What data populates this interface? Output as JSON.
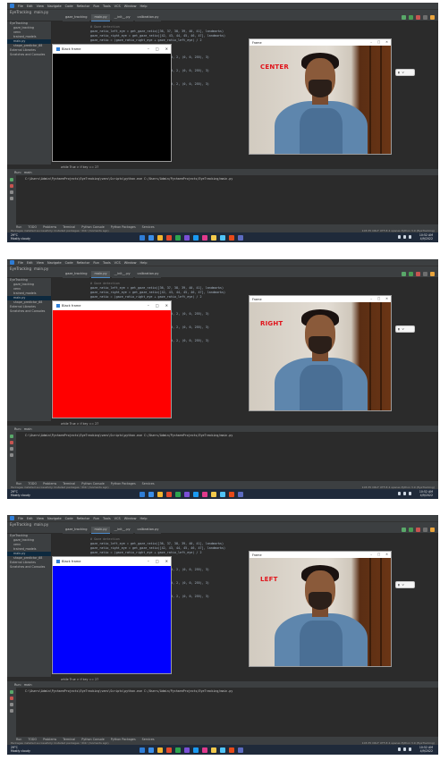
{
  "ide": {
    "menu": [
      "File",
      "Edit",
      "View",
      "Navigate",
      "Code",
      "Refactor",
      "Run",
      "Tools",
      "VCS",
      "Window",
      "Help"
    ],
    "breadcrumb": [
      "EyeTracking",
      "main.py"
    ],
    "tabs": [
      "gaze_tracking",
      "main.py",
      "__init__.py",
      "calibration.py"
    ],
    "project_tree": [
      "EyeTracking",
      "gaze_tracking",
      "venv",
      "trained_models",
      "main.py",
      "shape_predictor_68",
      "External Libraries",
      "Scratches and Consoles"
    ],
    "code_lines": [
      "# Gaze detection",
      "gaze_ratio_left_eye = get_gaze_ratio([36, 37, 38, 39, 40, 41], landmarks)",
      "gaze_ratio_right_eye = get_gaze_ratio([42, 43, 44, 45, 46, 47], landmarks)",
      "gaze_ratio = (gaze_ratio_right_eye + gaze_ratio_left_eye) / 2"
    ],
    "code_fragments": [
      "ed, 2, (0, 0, 255), 3)",
      "ed, 2, (0, 0, 255), 3)",
      "ed, 2, (0, 0, 255), 3)"
    ],
    "status_line": "while True  >  if key == 27",
    "run_tab": "main",
    "run_command": "C:\\Users\\Admin\\PycharmProjects\\EyeTracking\\venv\\Scripts\\python.exe C:/Users/Admin/PycharmProjects/EyeTracking/main.py",
    "bottom_tools": [
      "Run",
      "TODO",
      "Problems",
      "Terminal",
      "Python Console",
      "Python Packages",
      "Services"
    ],
    "statusbar_left": "Packages installed successfully: Installed packages: 'dlib' (moments ago)",
    "statusbar_right": "103:35  CRLF  UTF-8  4 spaces  Python 3.9 (EyeTracking)"
  },
  "taskbar": {
    "weather_temp": "29°C",
    "weather_desc": "Mostly cloudy",
    "time": "10:52 AM",
    "date": "4/9/2022",
    "icon_colors": [
      "#2f7dd6",
      "#3b8ee8",
      "#f2b530",
      "#e24a2b",
      "#2da44e",
      "#7a4fd6",
      "#1a9af2",
      "#e03a8c",
      "#f2c94c",
      "#4fc3f7",
      "#e64a19",
      "#5c6bc0"
    ]
  },
  "frames": [
    {
      "black_window_title": "Black frame",
      "frame_window_title": "Frame",
      "direction": "CENTER",
      "fill_color": "#000000",
      "popup_label": "V"
    },
    {
      "black_window_title": "Black frame",
      "frame_window_title": "Frame",
      "direction": "RIGHT",
      "fill_color": "#ff0000",
      "popup_label": "V"
    },
    {
      "black_window_title": "Black frame",
      "frame_window_title": "Frame",
      "direction": "LEFT",
      "fill_color": "#0000ff",
      "popup_label": "V"
    }
  ],
  "colors": {
    "ide_bg": "#2b2b2b",
    "accent": "#4a88c7",
    "label_red": "#e1141b"
  }
}
